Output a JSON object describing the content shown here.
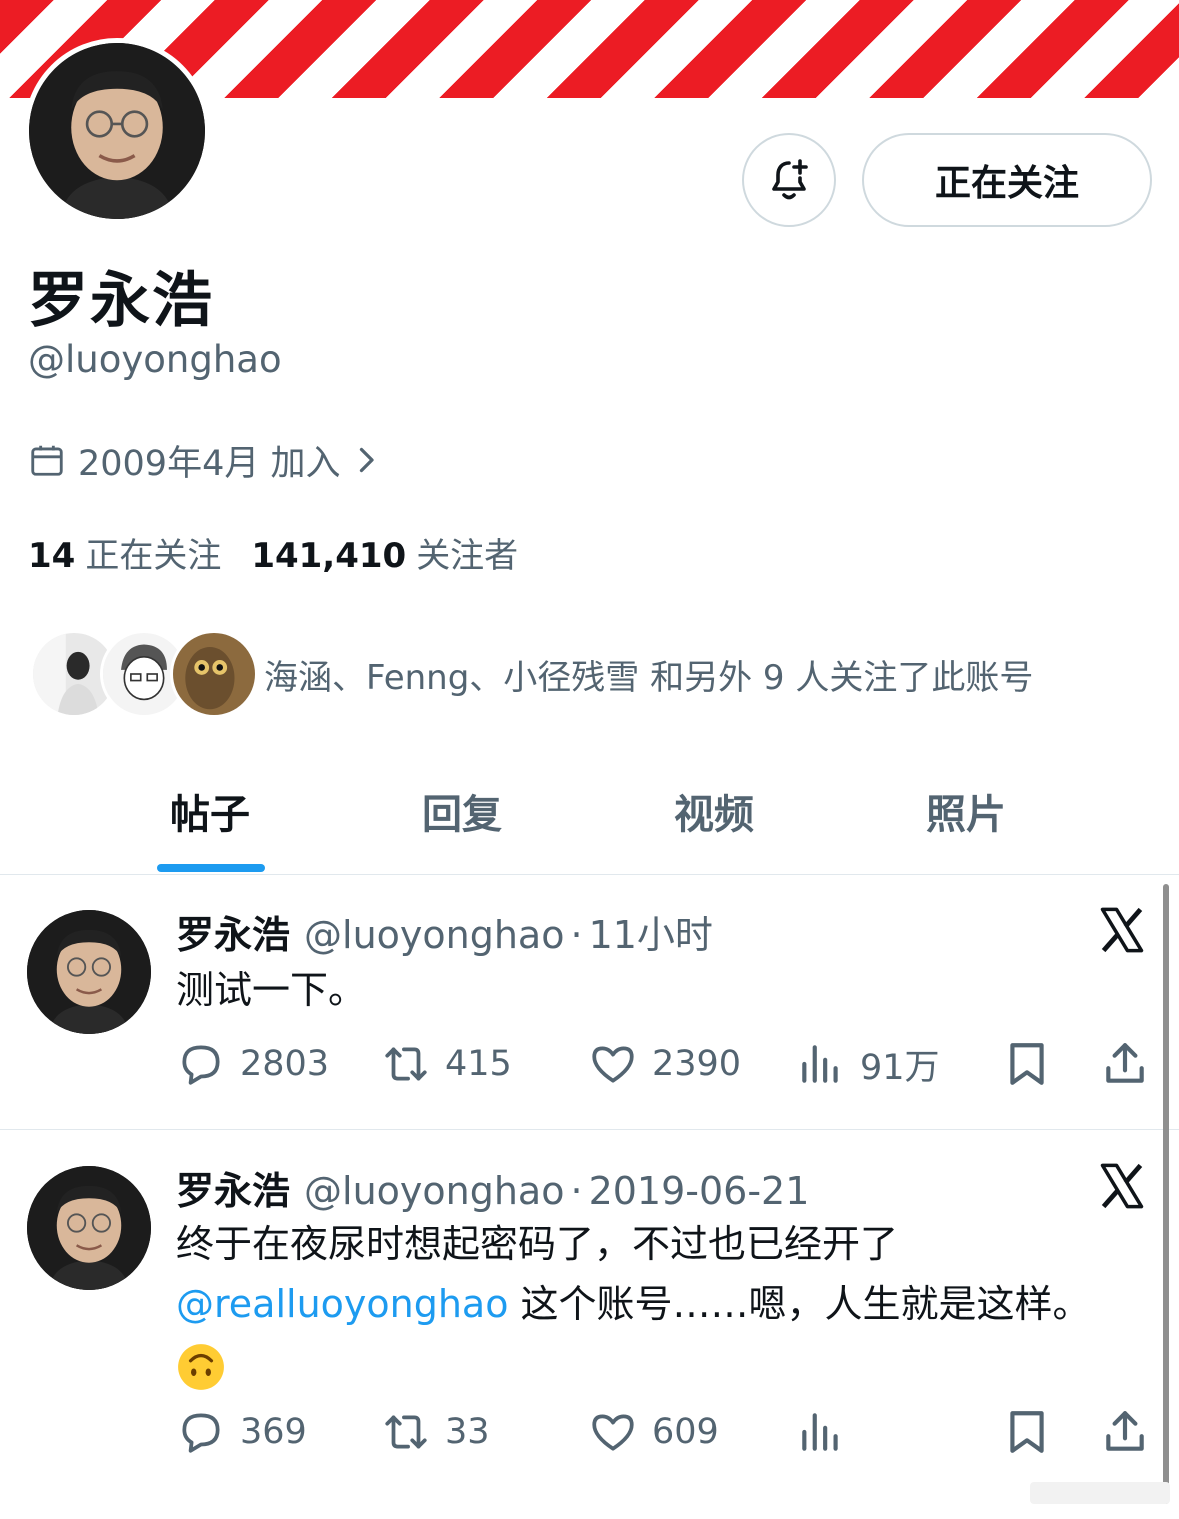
{
  "profile": {
    "display_name": "罗永浩",
    "handle": "@luoyonghao",
    "joined": "2009年4月 加入",
    "follow_button": "正在关注",
    "following_count": "14",
    "following_label": "正在关注",
    "followers_count": "141,410",
    "followers_label": "关注者",
    "followed_by": "海涵、Fenng、小径残雪 和另外 9 人关注了此账号"
  },
  "tabs": [
    {
      "label": "帖子",
      "active": true
    },
    {
      "label": "回复",
      "active": false
    },
    {
      "label": "视频",
      "active": false
    },
    {
      "label": "照片",
      "active": false
    }
  ],
  "posts": [
    {
      "name": "罗永浩",
      "handle": "@luoyonghao",
      "sep": "·",
      "time": "11小时",
      "text": "测试一下。",
      "replies": "2803",
      "reposts": "415",
      "likes": "2390",
      "views": "91万"
    },
    {
      "name": "罗永浩",
      "handle": "@luoyonghao",
      "sep": "·",
      "time": "2019-06-21",
      "text_line1": "终于在夜尿时想起密码了，不过也已经开了",
      "mention": "@realluoyonghao",
      "text_line2_rest": " 这个账号……嗯，人生就是这样。",
      "emoji": "upside-down-face",
      "replies": "369",
      "reposts": "33",
      "likes": "609",
      "views": ""
    }
  ],
  "colors": {
    "accent": "#1d9bf0",
    "banner_red": "#ec1c24",
    "secondary_text": "#536471",
    "primary_text": "#0f1419"
  }
}
